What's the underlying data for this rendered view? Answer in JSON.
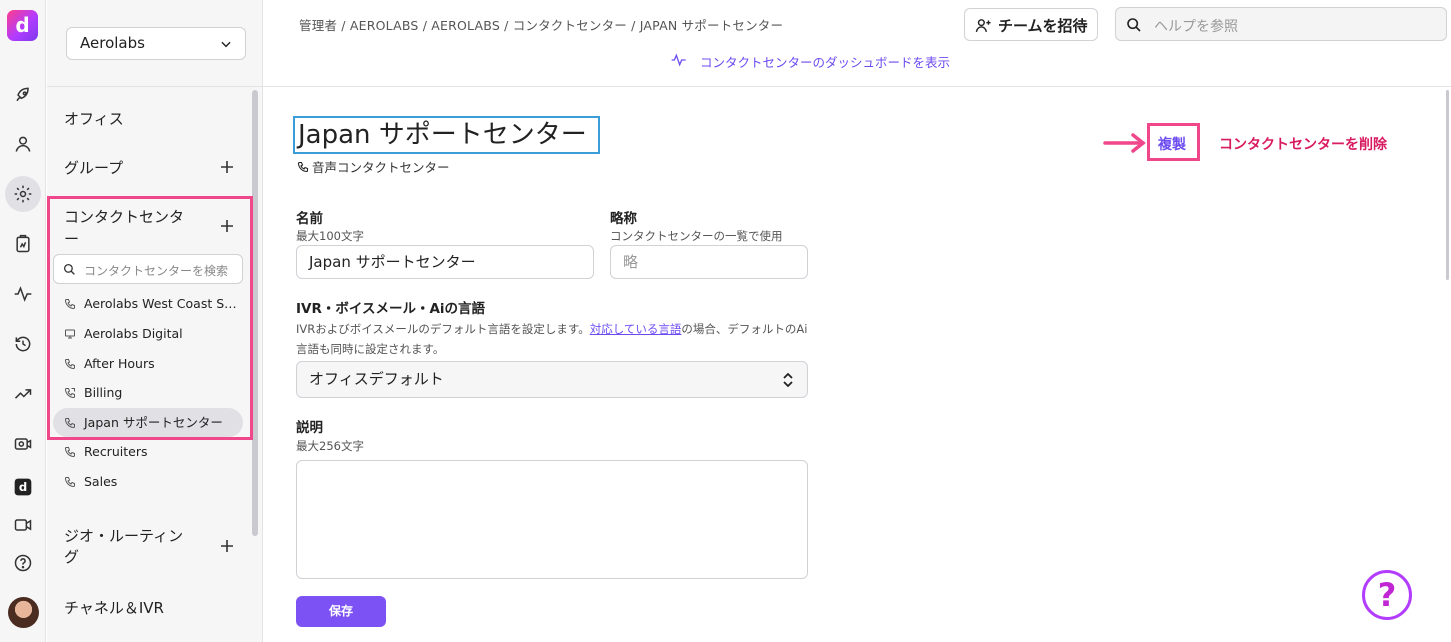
{
  "rail": {
    "logo": "d",
    "icons": [
      "rocket-icon",
      "person-icon",
      "gear-icon",
      "clipboard-icon",
      "activity-icon",
      "history-icon",
      "trend-icon",
      "camera-switch-icon",
      "dialpad-logo-icon",
      "video-icon",
      "help-circle-icon"
    ]
  },
  "sidebar": {
    "org": "Aerolabs",
    "sections": {
      "office": "オフィス",
      "groups": "グループ",
      "contact_centers": "コンタクトセンター",
      "geo_routing": "ジオ・ルーティング",
      "channels_ivr": "チャネル＆IVR"
    },
    "search_placeholder": "コンタクトセンターを検索",
    "contact_centers": [
      {
        "label": "Aerolabs West Coast Support",
        "icon": "phone-icon"
      },
      {
        "label": "Aerolabs Digital",
        "icon": "monitor-icon"
      },
      {
        "label": "After Hours",
        "icon": "phone-icon"
      },
      {
        "label": "Billing",
        "icon": "phone-arrows-icon"
      },
      {
        "label": "Japan サポートセンター",
        "icon": "phone-icon",
        "active": true
      },
      {
        "label": "Recruiters",
        "icon": "phone-icon"
      },
      {
        "label": "Sales",
        "icon": "phone-icon"
      }
    ]
  },
  "header": {
    "breadcrumb": "管理者 / AEROLABS / AEROLABS / コンタクトセンター / JAPAN サポートセンター",
    "dashboard_link": "コンタクトセンターのダッシュボードを表示",
    "invite_label": "チームを招待",
    "help_placeholder": "ヘルプを参照"
  },
  "main": {
    "title": "Japan サポートセンター",
    "type": "音声コンタクトセンター",
    "duplicate": "複製",
    "delete": "コンタクトセンターを削除",
    "name": {
      "label": "名前",
      "hint": "最大100文字",
      "value": "Japan サポートセンター"
    },
    "abbr": {
      "label": "略称",
      "hint": "コンタクトセンターの一覧で使用",
      "placeholder": "略"
    },
    "ivr": {
      "label": "IVR・ボイスメール・Aiの言語",
      "desc_before": "IVRおよびボイスメールのデフォルト言語を設定します。",
      "desc_link": "対応している言語",
      "desc_after": "の場合、デフォルトのAi言語も同時に設定されます。",
      "value": "オフィスデフォルト"
    },
    "description": {
      "label": "説明",
      "hint": "最大256文字",
      "value": ""
    },
    "save": "保存"
  },
  "colors": {
    "accent": "#7c52f5",
    "highlight": "#f0478b",
    "danger": "#d81b60",
    "title_border": "#3b9ed8"
  }
}
